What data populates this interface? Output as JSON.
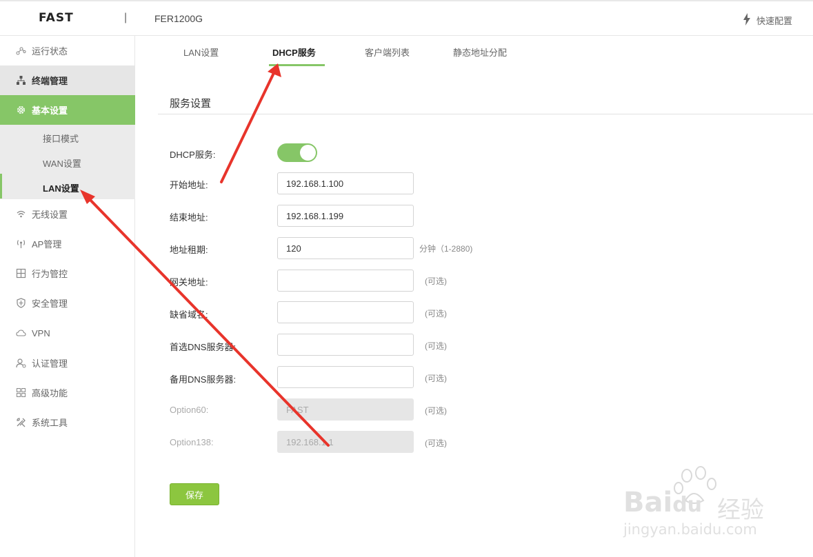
{
  "header": {
    "brand": "FAST",
    "separator": "|",
    "model": "FER1200G",
    "quick_setup": "快速配置"
  },
  "sidebar": {
    "items": [
      {
        "label": "运行状态",
        "icon": "status-icon"
      },
      {
        "label": "终端管理",
        "icon": "network-icon"
      },
      {
        "label": "基本设置",
        "icon": "gear-icon"
      },
      {
        "label": "无线设置",
        "icon": "wifi-icon"
      },
      {
        "label": "AP管理",
        "icon": "ap-icon"
      },
      {
        "label": "行为管控",
        "icon": "behavior-icon"
      },
      {
        "label": "安全管理",
        "icon": "shield-icon"
      },
      {
        "label": "VPN",
        "icon": "vpn-icon"
      },
      {
        "label": "认证管理",
        "icon": "user-auth-icon"
      },
      {
        "label": "高级功能",
        "icon": "grid-icon"
      },
      {
        "label": "系统工具",
        "icon": "tools-icon"
      }
    ],
    "subitems": [
      "接口模式",
      "WAN设置",
      "LAN设置"
    ]
  },
  "tabs": [
    "LAN设置",
    "DHCP服务",
    "客户端列表",
    "静态地址分配"
  ],
  "section_title": "服务设置",
  "form": {
    "dhcp_label": "DHCP服务:",
    "dhcp_enabled": true,
    "start_label": "开始地址:",
    "start_value": "192.168.1.100",
    "end_label": "结束地址:",
    "end_value": "192.168.1.199",
    "lease_label": "地址租期:",
    "lease_value": "120",
    "lease_hint": "分钟（1-2880)",
    "gateway_label": "网关地址:",
    "gateway_value": "",
    "gateway_hint": "(可选)",
    "domain_label": "缺省域名:",
    "domain_value": "",
    "domain_hint": "(可选)",
    "dns1_label": "首选DNS服务器:",
    "dns1_value": "",
    "dns1_hint": "(可选)",
    "dns2_label": "备用DNS服务器:",
    "dns2_value": "",
    "dns2_hint": "(可选)",
    "opt60_label": "Option60:",
    "opt60_value": "FAST",
    "opt60_hint": "(可选)",
    "opt138_label": "Option138:",
    "opt138_value": "192.168.1.1",
    "opt138_hint": "(可选)",
    "save_label": "保存"
  },
  "watermark": {
    "brand": "Bai",
    "brand2": "du",
    "cn": "经验",
    "url": "jingyan.baidu.com"
  },
  "colors": {
    "accent": "#86c667",
    "arrow": "#e8342b",
    "save": "#8cc63f"
  }
}
